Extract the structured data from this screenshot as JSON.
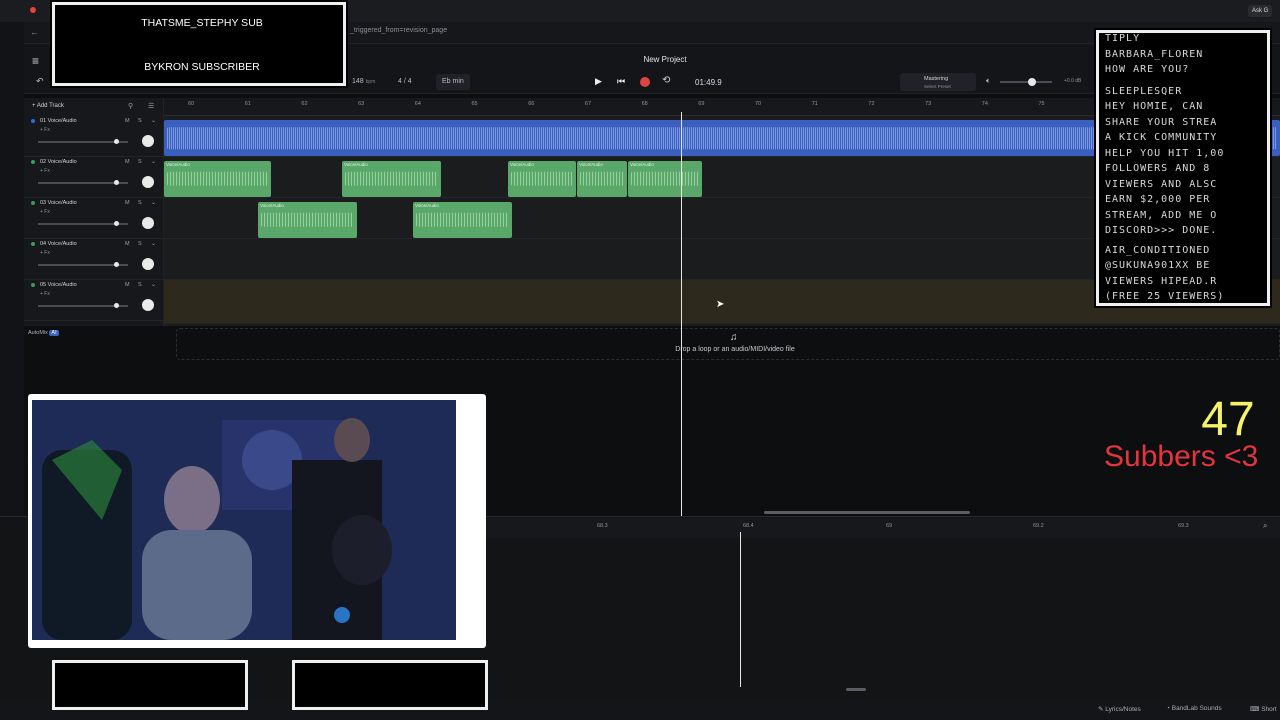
{
  "browser": {
    "url_fragment": "_triggered_from=revision_page",
    "ask_label": "Ask G"
  },
  "header": {
    "project_title": "New Project",
    "tempo": "148",
    "tempo_unit": "bpm",
    "time_signature": "4 / 4",
    "key": "Eb min",
    "time": "01:49.9",
    "mastering_label": "Mastering",
    "mastering_preset": "Select Preset",
    "db_label": "+0.0 dB"
  },
  "tracks_panel": {
    "add_track_label": "Add Track",
    "tracks": [
      {
        "name": "01 Voice/Audio",
        "fx": "+ Fx",
        "m": "M",
        "s": "S",
        "led": "blue"
      },
      {
        "name": "02 Voice/Audio",
        "fx": "+ Fx",
        "m": "M",
        "s": "S",
        "led": "green"
      },
      {
        "name": "03 Voice/Audio",
        "fx": "+ Fx",
        "m": "M",
        "s": "S",
        "led": "green"
      },
      {
        "name": "04 Voice/Audio",
        "fx": "+ Fx",
        "m": "M",
        "s": "S",
        "led": "green"
      },
      {
        "name": "05 Voice/Audio",
        "fx": "+ Fx",
        "m": "M",
        "s": "S",
        "led": "green"
      }
    ],
    "automix_label": "AutoMix",
    "automix_badge": "AI"
  },
  "ruler": [
    "60",
    "61",
    "62",
    "63",
    "64",
    "65",
    "66",
    "67",
    "68",
    "69",
    "70",
    "71",
    "72",
    "73",
    "74",
    "75"
  ],
  "clip_label": "Voice/Audio",
  "drop_zone_text": "Drop a loop or an audio/MIDI/video file",
  "editor_ruler": [
    "68.2",
    "68.3",
    "68.4",
    "69",
    "69.2",
    "69.3"
  ],
  "statusbar": {
    "lyrics": "Lyrics/Notes",
    "sounds": "BandLab Sounds",
    "shortcuts": "Short"
  },
  "overlay": {
    "sub_top": "THATSME_STEPHY SUB",
    "sub_bottom": "BYKRON SUBSCRIBER",
    "chat": [
      "TIPLY",
      "BARBARA_FLOREN",
      "HOW ARE YOU?",
      "SLEEPLESQER",
      "HEY HOMIE, CAN",
      "SHARE YOUR STREA",
      "A KICK COMMUNITY",
      "HELP YOU HIT 1,00",
      "FOLLOWERS AND 8",
      "VIEWERS AND ALSC",
      "EARN $2,000 PER",
      "STREAM, ADD ME O",
      "DISCORD>>> DONE.",
      "AIR_CONDITIONED",
      "@SUKUNA901XX BE",
      "VIEWERS HIPEAD.R",
      "(FREE 25 VIEWERS)"
    ],
    "sub_count": "47",
    "sub_label": "Subbers <3"
  },
  "colors": {
    "accent_blue": "#3a5fbe",
    "clip_green": "#59a86a",
    "record_red": "#e0443e",
    "sub_count_yellow": "#f4f36a",
    "sub_label_red": "#e2353d"
  }
}
